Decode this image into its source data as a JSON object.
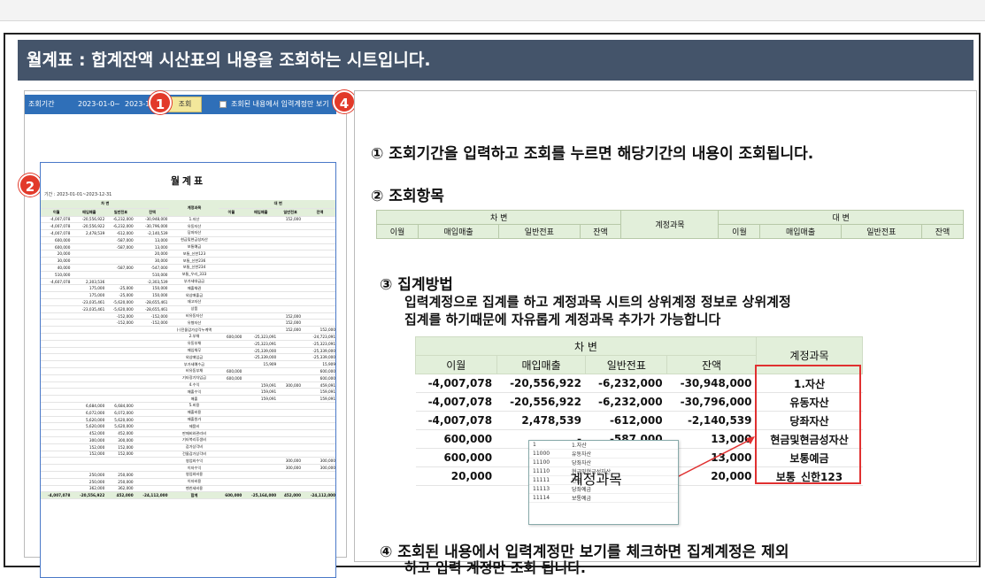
{
  "title": "월계표 : 합계잔액 시산표의 내용을 조회하는 시트입니다.",
  "toolbar": {
    "period_label": "조회기간",
    "start_date": "2023-01-01",
    "tilde": "~",
    "end_date": "2023-12-",
    "query_button": "조회",
    "only_input_label": "조회된 내용에서 입력계정만 보기"
  },
  "badges": [
    "1",
    "2",
    "3",
    "4"
  ],
  "sheet": {
    "title": "월계표",
    "period": "기간 : 2023-01-01~2023-12-31",
    "header_debit": "차 변",
    "header_credit": "대 변",
    "header_account": "계정과목",
    "cols": [
      "이월",
      "매입매출",
      "일반전표",
      "잔액"
    ],
    "rows": [
      [
        "-4,007,078",
        "-20,556,922",
        "-6,232,000",
        "-30,948,000",
        "1.자산",
        "",
        "",
        "152,000",
        ""
      ],
      [
        "-4,007,078",
        "-20,556,922",
        "-6,232,000",
        "-30,796,000",
        "유동자산",
        "",
        "",
        "",
        ""
      ],
      [
        "-4,007,078",
        "2,478,539",
        "-612,000",
        "-2,140,539",
        "당좌자산",
        "",
        "",
        "",
        ""
      ],
      [
        "600,000",
        "",
        "-587,000",
        "13,000",
        "현금및현금성자산",
        "",
        "",
        "",
        ""
      ],
      [
        "600,000",
        "",
        "-587,000",
        "13,000",
        "보통예금",
        "",
        "",
        "",
        ""
      ],
      [
        "20,000",
        "",
        "",
        "20,000",
        "보통_신한123",
        "",
        "",
        "",
        ""
      ],
      [
        "30,000",
        "",
        "",
        "30,000",
        "보통_신한236",
        "",
        "",
        "",
        ""
      ],
      [
        "40,000",
        "",
        "-587,000",
        "-547,000",
        "보통_신한234",
        "",
        "",
        "",
        ""
      ],
      [
        "510,000",
        "",
        "",
        "510,000",
        "보통_우리_333",
        "",
        "",
        "",
        ""
      ],
      [
        "-4,607,078",
        "2,303,536",
        "",
        "-2,303,539",
        "부가세대급금",
        "",
        "",
        "",
        ""
      ],
      [
        "",
        "175,000",
        "-25,000",
        "150,000",
        "매출채권",
        "",
        "",
        "",
        ""
      ],
      [
        "",
        "175,000",
        "-25,000",
        "150,000",
        "외상매출금",
        "",
        "",
        "",
        ""
      ],
      [
        "",
        "-23,035,461",
        "-5,620,000",
        "-28,655,461",
        "재고자산",
        "",
        "",
        "",
        ""
      ],
      [
        "",
        "-23,035,461",
        "-5,620,000",
        "-28,655,461",
        "상품",
        "",
        "",
        "",
        ""
      ],
      [
        "",
        "",
        "-152,000",
        "-152,000",
        "비유동자산",
        "",
        "",
        "152,000",
        ""
      ],
      [
        "",
        "",
        "-152,000",
        "-152,000",
        "유형자산",
        "",
        "",
        "152,000",
        ""
      ],
      [
        "",
        "",
        "",
        "",
        "(-)전물감가상각누계액",
        "",
        "",
        "152,000",
        "152,000"
      ],
      [
        "",
        "",
        "",
        "",
        "2.부채",
        "600,000",
        "-25,323,091",
        "",
        "-24,723,091"
      ],
      [
        "",
        "",
        "",
        "",
        "유동부채",
        "",
        "-25,323,091",
        "",
        "-25,323,091"
      ],
      [
        "",
        "",
        "",
        "",
        "매입채무",
        "",
        "-25,339,000",
        "",
        "-25,339,000"
      ],
      [
        "",
        "",
        "",
        "",
        "외상매입금",
        "",
        "-25,339,000",
        "",
        "-25,339,000"
      ],
      [
        "",
        "",
        "",
        "",
        "부가세예수금",
        "",
        "15,909",
        "",
        "15,909"
      ],
      [
        "",
        "",
        "",
        "",
        "비유동부채",
        "600,000",
        "",
        "",
        "600,000"
      ],
      [
        "",
        "",
        "",
        "",
        "기타장기차입금",
        "600,000",
        "",
        "",
        "600,000"
      ],
      [
        "",
        "",
        "",
        "",
        "4.수익",
        "",
        "159,091",
        "300,000",
        "459,091"
      ],
      [
        "",
        "",
        "",
        "",
        "매출수익",
        "",
        "159,091",
        "",
        "159,091"
      ],
      [
        "",
        "",
        "",
        "",
        "매출",
        "",
        "159,091",
        "",
        "159,091"
      ],
      [
        "",
        "6,684,000",
        "6,684,000",
        "",
        "5.비용",
        "",
        "",
        "",
        ""
      ],
      [
        "",
        "6,072,000",
        "6,072,000",
        "",
        "매출비용",
        "",
        "",
        "",
        ""
      ],
      [
        "",
        "5,620,000",
        "5,620,000",
        "",
        "매출원가",
        "",
        "",
        "",
        ""
      ],
      [
        "",
        "5,620,000",
        "5,620,000",
        "",
        "제품비",
        "",
        "",
        "",
        ""
      ],
      [
        "",
        "452,000",
        "452,000",
        "",
        "판매비와관리비",
        "",
        "",
        "",
        ""
      ],
      [
        "",
        "300,000",
        "300,000",
        "",
        "기타복리후생비",
        "",
        "",
        "",
        ""
      ],
      [
        "",
        "152,000",
        "152,000",
        "",
        "감가상각비",
        "",
        "",
        "",
        ""
      ],
      [
        "",
        "152,000",
        "152,000",
        "",
        "건물감가상각비",
        "",
        "",
        "",
        ""
      ],
      [
        "",
        "",
        "",
        "",
        "영업외수익",
        "",
        "",
        "300,000",
        "300,000"
      ],
      [
        "",
        "",
        "",
        "",
        "이자수익",
        "",
        "",
        "300,000",
        "300,000"
      ],
      [
        "",
        "250,000",
        "250,000",
        "",
        "영업외비용",
        "",
        "",
        "",
        ""
      ],
      [
        "",
        "250,000",
        "250,000",
        "",
        "이자비용",
        "",
        "",
        "",
        ""
      ],
      [
        "",
        "362,000",
        "362,000",
        "",
        "벤친세비용",
        "",
        "",
        "",
        ""
      ]
    ],
    "total": [
      "-4,007,078",
      "-20,556,922",
      "452,000",
      "-24,112,000",
      "합계",
      "600,000",
      "-25,164,000",
      "452,000",
      "-24,112,000"
    ]
  },
  "steps": {
    "s1": "① 조회기간을 입력하고 조회를 누르면 해당기간의 내용이 조회됩니다.",
    "s2": "② 조회항목",
    "s3": "③ 집계방법",
    "s3_line1": "입력계정으로 집계를 하고 계정과목 시트의 상위계정 정보로 상위계정",
    "s3_line2": "집계를 하기때문에 자유롭게 계정과목 추가가 가능합니다",
    "s4_line1": "④ 조회된 내용에서 입력계정만 보기를 체크하면 집계계정은 제외",
    "s4_line2": "하고 입력 계정만 조회 됩니다."
  },
  "header_table": {
    "debit": "차  변",
    "credit": "대  변",
    "account": "계정과목",
    "cols": [
      "이월",
      "매입매출",
      "일반전표",
      "잔액"
    ]
  },
  "big_table": {
    "debit": "차  변",
    "account": "계정과목",
    "cols": [
      "이월",
      "매입매출",
      "일반전표",
      "잔액"
    ],
    "rows": [
      [
        "-4,007,078",
        "-20,556,922",
        "-6,232,000",
        "-30,948,000",
        "1.자산"
      ],
      [
        "-4,007,078",
        "-20,556,922",
        "-6,232,000",
        "-30,796,000",
        "유동자산"
      ],
      [
        "-4,007,078",
        "2,478,539",
        "-612,000",
        "-2,140,539",
        "당좌자산"
      ],
      [
        "600,000",
        "-",
        "-587,000",
        "13,000",
        "현금및현금성자산"
      ],
      [
        "600,000",
        "",
        "",
        "13,000",
        "보통예금"
      ],
      [
        "20,000",
        "",
        "",
        "20,000",
        "보통_신한123"
      ]
    ]
  },
  "popup": {
    "label": "계정과목",
    "rows": [
      [
        "1",
        "1.자산"
      ],
      [
        "11000",
        "유동자산"
      ],
      [
        "11100",
        "당좌자산"
      ],
      [
        "11110",
        "현금및현금성자산"
      ],
      [
        "11111",
        "현금"
      ],
      [
        "11113",
        "당좌예금"
      ],
      [
        "11114",
        "보통예금"
      ]
    ]
  },
  "colors": {
    "banner": "#44546a",
    "toolbar": "#2f6fb8",
    "badge": "#e23a2a",
    "header_green": "#e2efda",
    "highlight_red": "#e03030"
  }
}
